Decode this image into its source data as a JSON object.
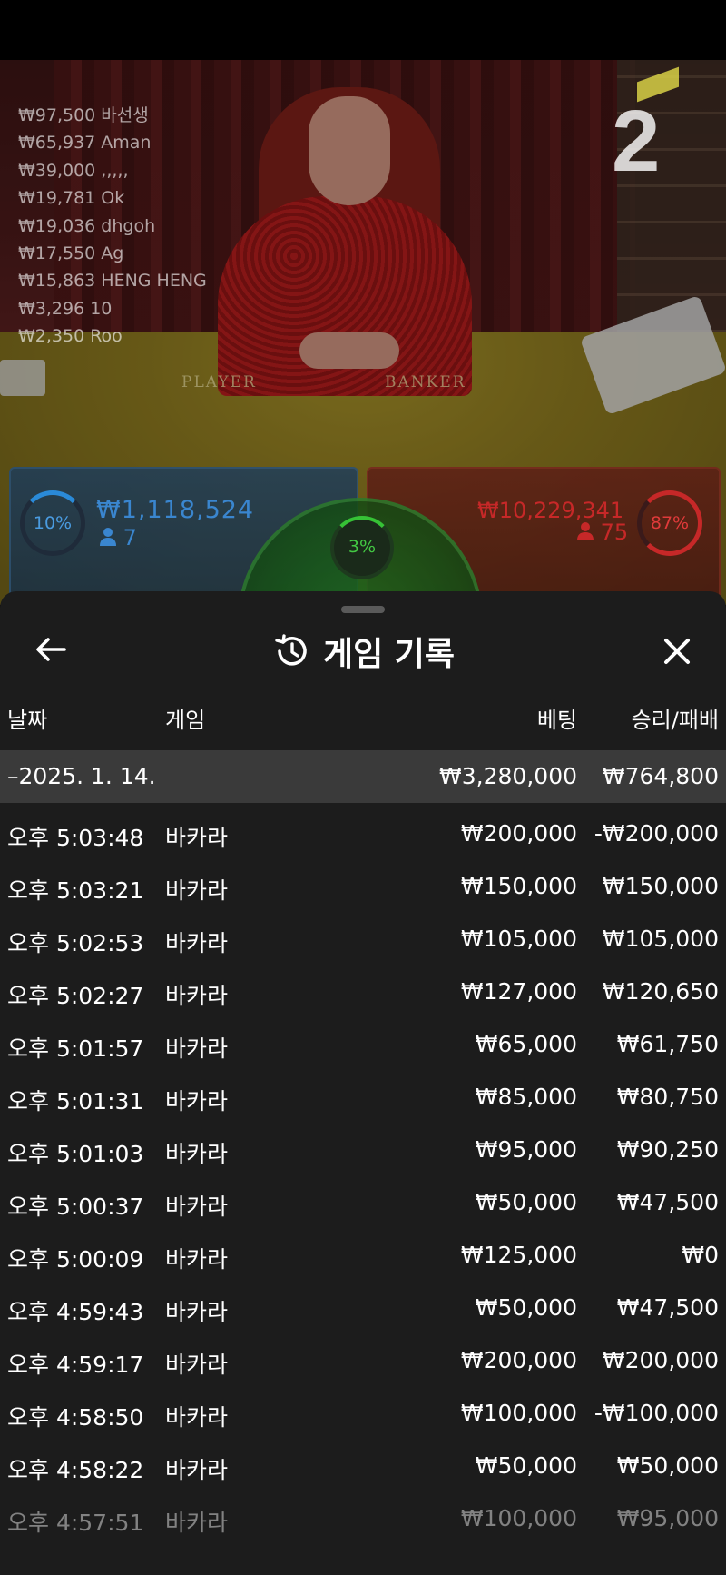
{
  "stream": {
    "round_number": "2",
    "table_words": {
      "player": "PLAYER",
      "banker": "BANKER"
    },
    "winners": [
      {
        "amount": "₩97,500",
        "name": "바선생"
      },
      {
        "amount": "₩65,937",
        "name": "Aman"
      },
      {
        "amount": "₩39,000",
        "name": ",,,,,"
      },
      {
        "amount": "₩19,781",
        "name": "Ok"
      },
      {
        "amount": "₩19,036",
        "name": "dhgoh"
      },
      {
        "amount": "₩17,550",
        "name": "Ag"
      },
      {
        "amount": "₩15,863",
        "name": "HENG HENG"
      },
      {
        "amount": "₩3,296",
        "name": "10"
      },
      {
        "amount": "₩2,350",
        "name": "Roo"
      }
    ]
  },
  "bets": {
    "player": {
      "percent": "10%",
      "amount": "₩1,118,524",
      "players": "7",
      "color": "#3a86cf"
    },
    "tie": {
      "percent": "3%",
      "color": "#43c843"
    },
    "banker": {
      "percent": "87%",
      "amount": "₩10,229,341",
      "players": "75",
      "color": "#c62828"
    }
  },
  "history": {
    "title": "게임 기록",
    "icons": {
      "back": "arrow-left-icon",
      "close": "close-icon",
      "title": "history-clock-icon",
      "person": "person-icon"
    },
    "columns": {
      "date": "날짜",
      "game": "게임",
      "bet": "베팅",
      "result": "승리/패배"
    },
    "summary": {
      "date": "–2025. 1. 14.",
      "bet": "₩3,280,000",
      "result": "₩764,800"
    },
    "rows": [
      {
        "time": "오후 5:03:48",
        "game": "바카라",
        "bet": "₩200,000",
        "result": "-₩200,000"
      },
      {
        "time": "오후 5:03:21",
        "game": "바카라",
        "bet": "₩150,000",
        "result": "₩150,000"
      },
      {
        "time": "오후 5:02:53",
        "game": "바카라",
        "bet": "₩105,000",
        "result": "₩105,000"
      },
      {
        "time": "오후 5:02:27",
        "game": "바카라",
        "bet": "₩127,000",
        "result": "₩120,650"
      },
      {
        "time": "오후 5:01:57",
        "game": "바카라",
        "bet": "₩65,000",
        "result": "₩61,750"
      },
      {
        "time": "오후 5:01:31",
        "game": "바카라",
        "bet": "₩85,000",
        "result": "₩80,750"
      },
      {
        "time": "오후 5:01:03",
        "game": "바카라",
        "bet": "₩95,000",
        "result": "₩90,250"
      },
      {
        "time": "오후 5:00:37",
        "game": "바카라",
        "bet": "₩50,000",
        "result": "₩47,500"
      },
      {
        "time": "오후 5:00:09",
        "game": "바카라",
        "bet": "₩125,000",
        "result": "₩0"
      },
      {
        "time": "오후 4:59:43",
        "game": "바카라",
        "bet": "₩50,000",
        "result": "₩47,500"
      },
      {
        "time": "오후 4:59:17",
        "game": "바카라",
        "bet": "₩200,000",
        "result": "₩200,000"
      },
      {
        "time": "오후 4:58:50",
        "game": "바카라",
        "bet": "₩100,000",
        "result": "-₩100,000"
      },
      {
        "time": "오후 4:58:22",
        "game": "바카라",
        "bet": "₩50,000",
        "result": "₩50,000"
      },
      {
        "time": "오후 4:57:51",
        "game": "바카라",
        "bet": "₩100,000",
        "result": "₩95,000"
      }
    ]
  }
}
